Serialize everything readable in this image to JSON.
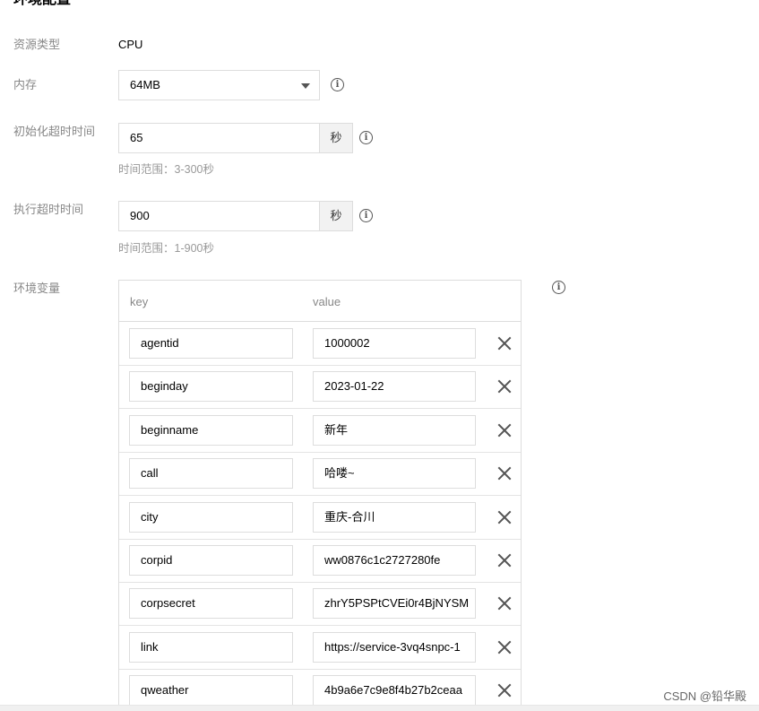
{
  "section": {
    "title": "环境配置"
  },
  "resource_type": {
    "label": "资源类型",
    "value": "CPU"
  },
  "memory": {
    "label": "内存",
    "value": "64MB",
    "info_icon": "info-circle-icon"
  },
  "init_timeout": {
    "label": "初始化超时时间",
    "value": "65",
    "unit": "秒",
    "hint": "时间范围：3-300秒"
  },
  "exec_timeout": {
    "label": "执行超时时间",
    "value": "900",
    "unit": "秒",
    "hint": "时间范围：1-900秒"
  },
  "env_vars": {
    "label": "环境变量",
    "key_header": "key",
    "value_header": "value",
    "rows": [
      {
        "key": "agentid",
        "value": "1000002"
      },
      {
        "key": "beginday",
        "value": "2023-01-22"
      },
      {
        "key": "beginname",
        "value": "新年"
      },
      {
        "key": "call",
        "value": "哈喽~"
      },
      {
        "key": "city",
        "value": "重庆-合川"
      },
      {
        "key": "corpid",
        "value": "ww0876c1c2727280fe"
      },
      {
        "key": "corpsecret",
        "value": "zhrY5PSPtCVEi0r4BjNYSM"
      },
      {
        "key": "link",
        "value": "https://service-3vq4snpc-1"
      },
      {
        "key": "qweather",
        "value": "4b9a6e7c9e8f4b27b2ceaa"
      }
    ]
  },
  "watermark": "CSDN @铅华殿",
  "colors": {
    "label": "#888888",
    "border": "#dddddd",
    "unit_bg": "#f2f2f2",
    "icon": "#555555"
  }
}
